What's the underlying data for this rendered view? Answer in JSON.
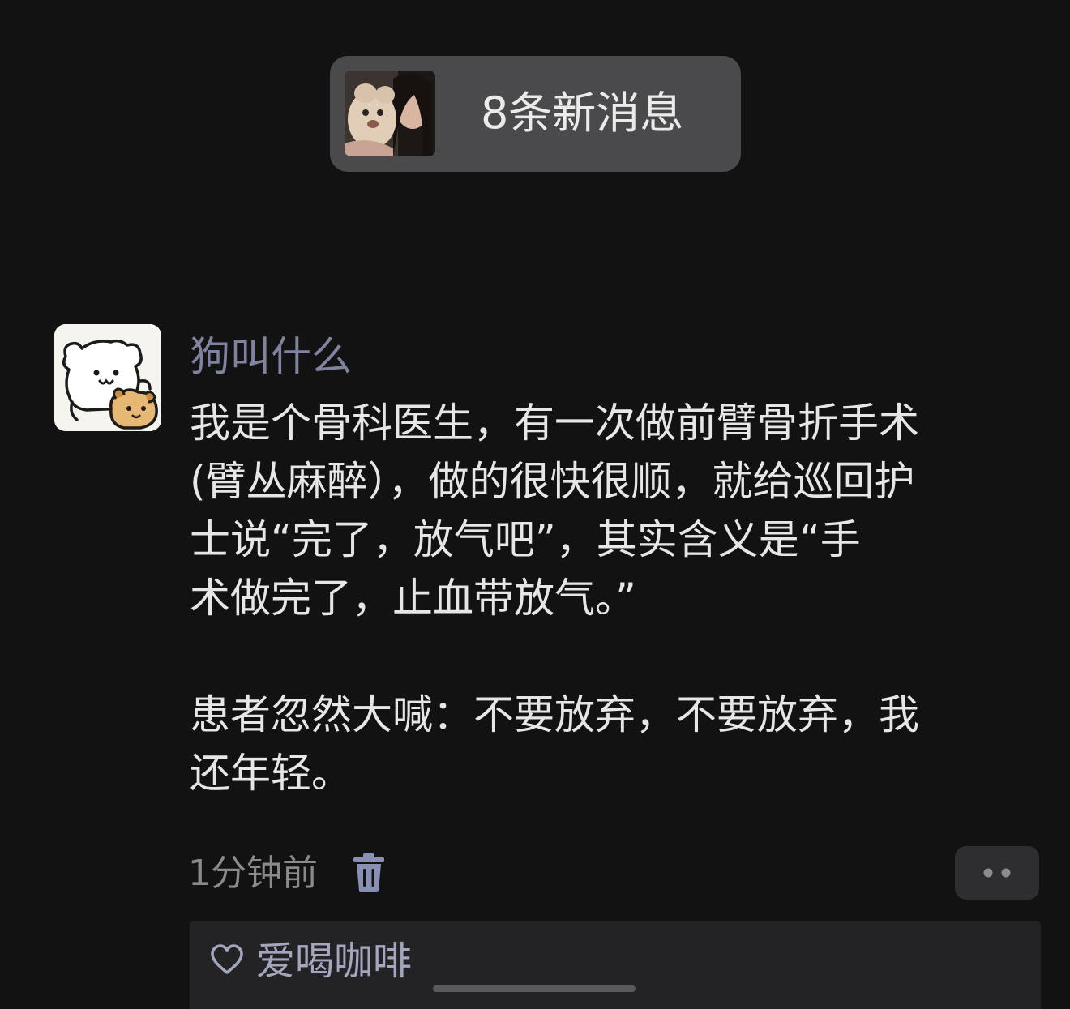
{
  "notification": {
    "text": "8条新消息",
    "avatar_icon": "user-photo-avatar"
  },
  "comment": {
    "avatar_icon": "cartoon-dog-avatar",
    "username": "狗叫什么",
    "lines": [
      "我是个骨科医生，有一次做前臂骨折手术",
      "(臂丛麻醉），做的很快很顺，就给巡回护",
      "士说“完了，放气吧”，其实含义是“手",
      "术做完了，止血带放气。”",
      "",
      "患者忽然大喊：不要放弃，不要放弃，我",
      "还年轻。"
    ],
    "timestamp": "1分钟前",
    "delete_icon": "trash-icon",
    "more_icon": "more-dots-icon"
  },
  "reply": {
    "icon": "heart-outline-icon",
    "name": "爱喝咖啡"
  },
  "colors": {
    "background": "#121212",
    "pill": "#4a4a4c",
    "username": "#7f83a0",
    "body_text": "#e6e6e6",
    "meta_text": "#8a8a8a",
    "trash": "#8a90b4",
    "reply_name": "#a3a6bd"
  }
}
